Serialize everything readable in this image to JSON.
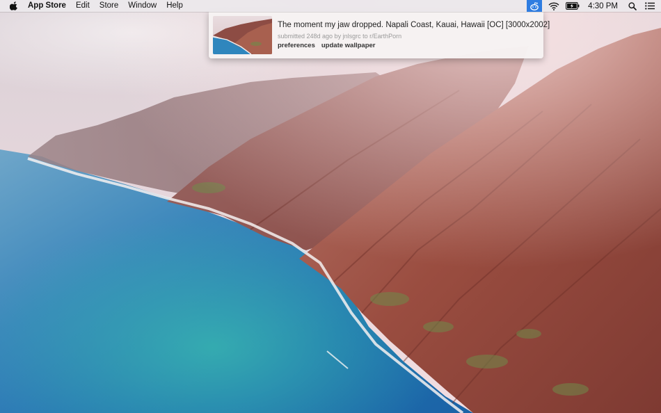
{
  "menubar": {
    "app_name": "App Store",
    "menus": [
      "Edit",
      "Store",
      "Window",
      "Help"
    ],
    "clock": "4:30 PM",
    "icons": {
      "apple": "apple-logo-icon",
      "status_app": "reddit-wallpaper-status-icon",
      "wifi": "wifi-icon",
      "battery": "battery-charging-icon",
      "search": "spotlight-search-icon",
      "notifications": "notification-center-icon"
    },
    "status_app_color": "#2f7de1"
  },
  "popover": {
    "title": "The moment my jaw dropped. Napali Coast, Kauai, Hawaii [OC] [3000x2002]",
    "meta": "submitted 248d ago by jnlsgrc to r/EarthPorn",
    "actions": {
      "preferences": "preferences",
      "update_wallpaper": "update wallpaper"
    }
  }
}
